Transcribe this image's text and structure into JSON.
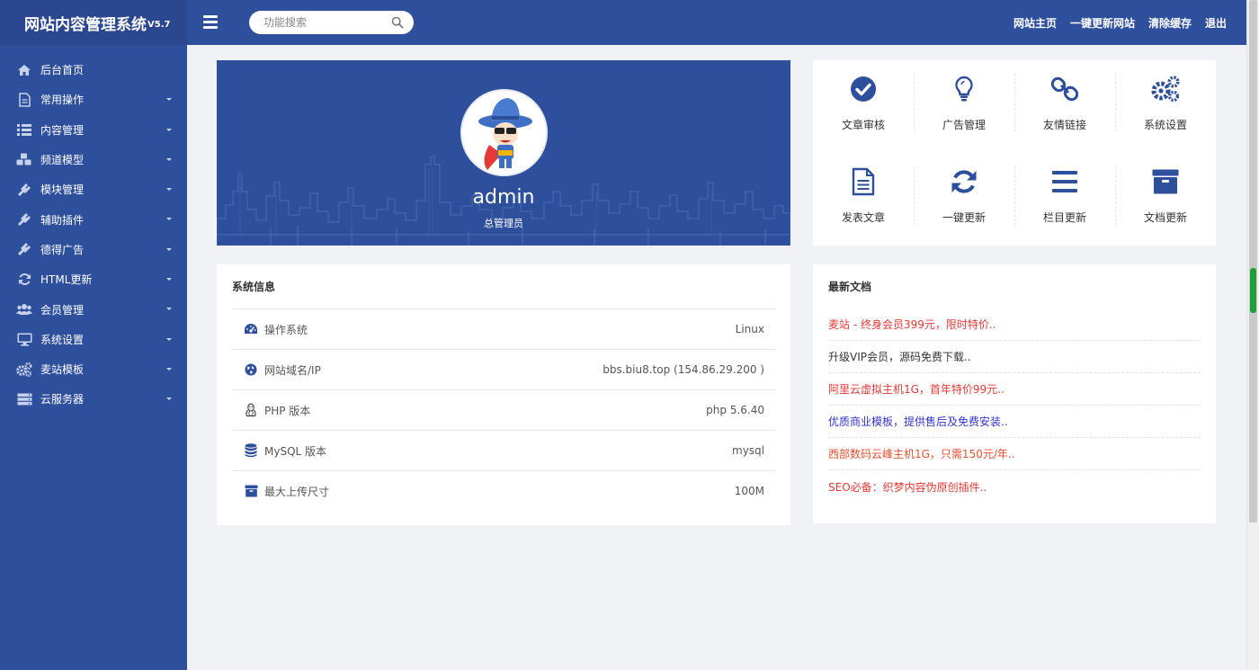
{
  "header": {
    "brand": "网站内容管理系统",
    "version": "V5.7",
    "search_placeholder": "功能搜索",
    "links": [
      "网站主页",
      "一键更新网站",
      "清除缓存",
      "退出"
    ]
  },
  "sidebar": {
    "items": [
      {
        "label": "后台首页",
        "icon": "home-icon"
      },
      {
        "label": "常用操作",
        "icon": "file-icon"
      },
      {
        "label": "内容管理",
        "icon": "list-icon"
      },
      {
        "label": "频道模型",
        "icon": "cubes-icon"
      },
      {
        "label": "模块管理",
        "icon": "plug-icon"
      },
      {
        "label": "辅助插件",
        "icon": "plug-icon"
      },
      {
        "label": "德得广告",
        "icon": "plug-icon"
      },
      {
        "label": "HTML更新",
        "icon": "refresh-icon"
      },
      {
        "label": "会员管理",
        "icon": "users-icon"
      },
      {
        "label": "系统设置",
        "icon": "desktop-icon"
      },
      {
        "label": "麦站模板",
        "icon": "cogs-icon"
      },
      {
        "label": "云服务器",
        "icon": "server-icon"
      }
    ]
  },
  "profile": {
    "name": "admin",
    "role": "总管理员"
  },
  "quick_actions": [
    {
      "label": "文章审核",
      "icon": "check-circle-icon"
    },
    {
      "label": "广告管理",
      "icon": "lightbulb-icon"
    },
    {
      "label": "友情链接",
      "icon": "link-icon"
    },
    {
      "label": "系统设置",
      "icon": "cogs-icon"
    },
    {
      "label": "发表文章",
      "icon": "document-icon"
    },
    {
      "label": "一键更新",
      "icon": "refresh-icon"
    },
    {
      "label": "栏目更新",
      "icon": "bars-icon"
    },
    {
      "label": "文档更新",
      "icon": "archive-icon"
    }
  ],
  "system_info": {
    "title": "系统信息",
    "rows": [
      {
        "label": "操作系统",
        "value": "Linux",
        "icon": "dashboard-icon"
      },
      {
        "label": "网站域名/IP",
        "value": "bbs.biu8.top (154.86.29.200 )",
        "icon": "globe-icon"
      },
      {
        "label": "PHP 版本",
        "value": "php 5.6.40",
        "icon": "linux-icon"
      },
      {
        "label": "MySQL 版本",
        "value": "mysql",
        "icon": "database-icon"
      },
      {
        "label": "最大上传尺寸",
        "value": "100M",
        "icon": "archive-icon"
      }
    ]
  },
  "latest_docs": {
    "title": "最新文档",
    "items": [
      {
        "text": "麦站 - 终身会员399元，限时特价..",
        "color": "#e53935"
      },
      {
        "text": "升级VIP会员，源码免费下载..",
        "color": "#333333"
      },
      {
        "text": "阿里云虚拟主机1G，首年特价99元..",
        "color": "#e53935"
      },
      {
        "text": "优质商业模板，提供售后及免费安装..",
        "color": "#3333cc"
      },
      {
        "text": "西部数码云峰主机1G，只需150元/年..",
        "color": "#e55030"
      },
      {
        "text": "SEO必备：织梦内容伪原创插件..",
        "color": "#e53935"
      }
    ]
  },
  "colors": {
    "primary": "#2e4f9c",
    "brand_bg": "#2a478f",
    "page_bg": "#f0f2f5"
  }
}
